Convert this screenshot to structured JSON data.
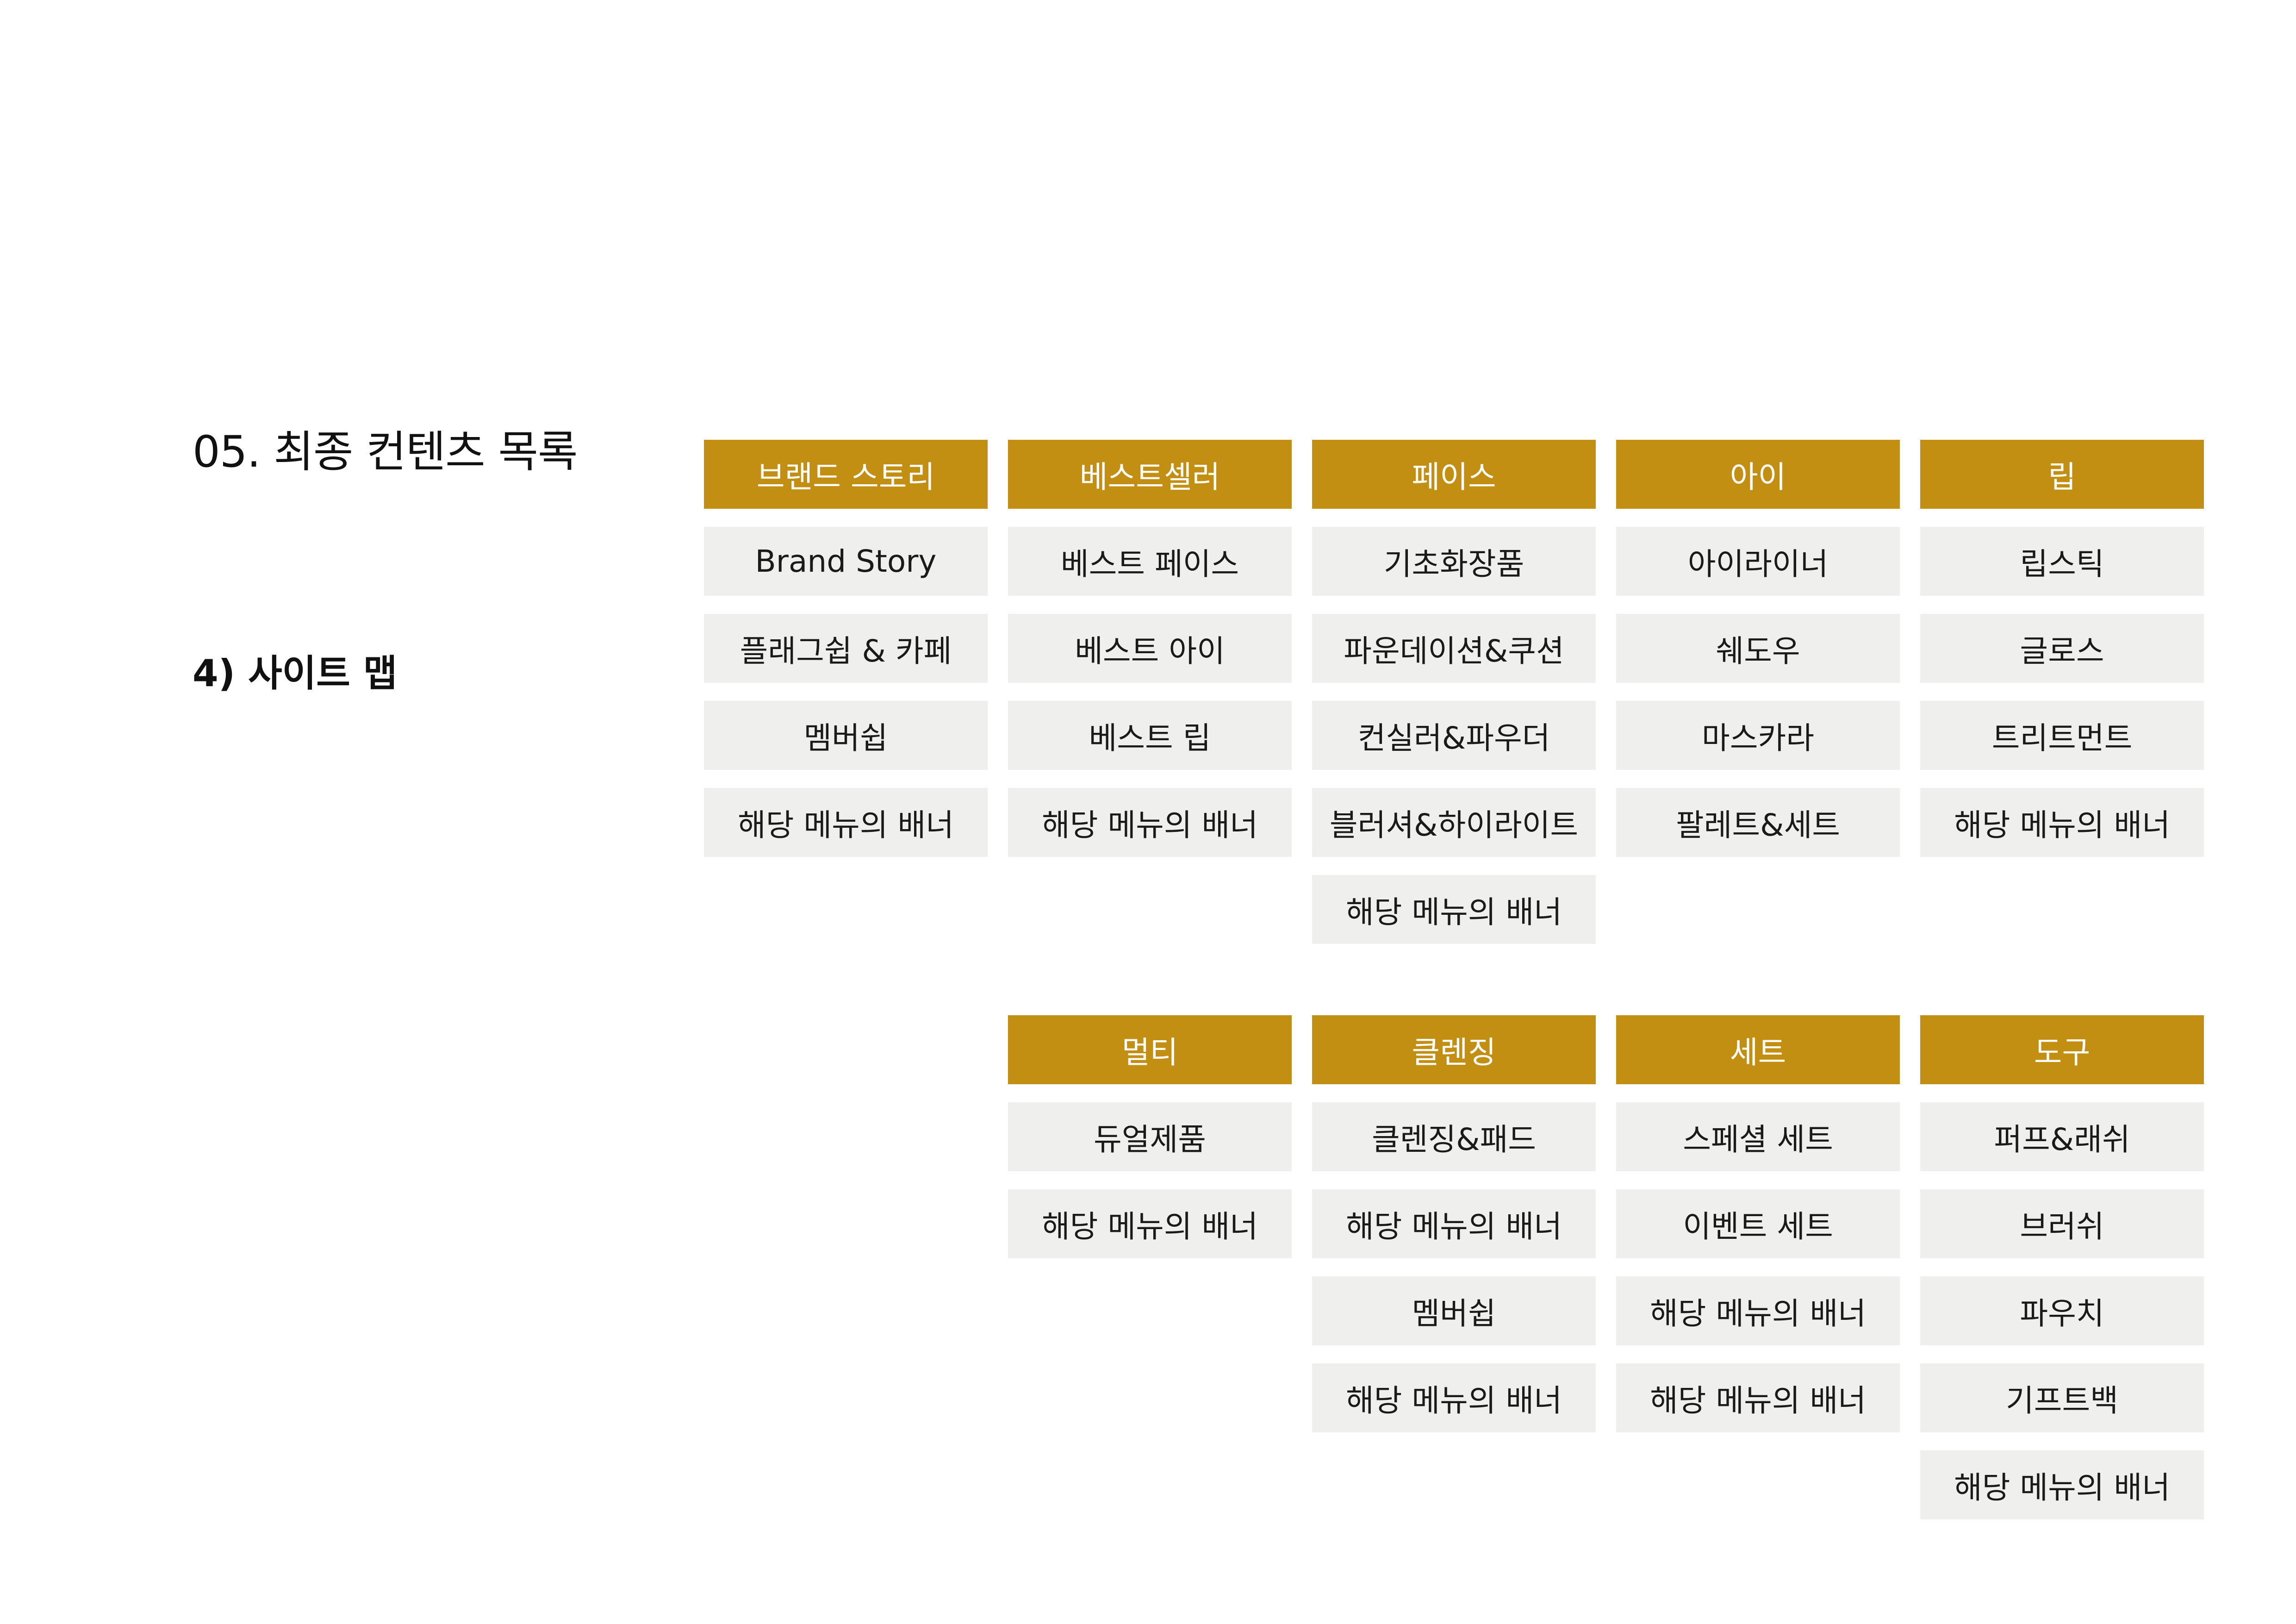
{
  "title": "05. 최종 컨텐츠 목록",
  "section": "4) 사이트 맵",
  "colors": {
    "header_bg": "#c28f12",
    "header_text": "#ffffff",
    "item_bg": "#efefed",
    "item_text": "#1a1a1a"
  },
  "columns": [
    {
      "header": "브랜드 스토리",
      "items": [
        "Brand Story",
        "플래그쉽 & 카페",
        "멤버쉽",
        "해당 메뉴의 배너"
      ]
    },
    {
      "header": "베스트셀러",
      "items": [
        "베스트 페이스",
        "베스트 아이",
        "베스트 립",
        "해당 메뉴의 배너"
      ]
    },
    {
      "header": "페이스",
      "items": [
        "기초화장품",
        "파운데이션&쿠션",
        "컨실러&파우더",
        "블러셔&하이라이트",
        "해당 메뉴의 배너"
      ]
    },
    {
      "header": "아이",
      "items": [
        "아이라이너",
        "쉐도우",
        "마스카라",
        "팔레트&세트"
      ]
    },
    {
      "header": "립",
      "items": [
        "립스틱",
        "글로스",
        "트리트먼트",
        "해당 메뉴의 배너"
      ]
    },
    {
      "header": "멀티",
      "items": [
        "듀얼제품",
        "해당 메뉴의 배너"
      ]
    },
    {
      "header": "클렌징",
      "items": [
        "클렌징&패드",
        "해당 메뉴의 배너",
        "멤버쉽",
        "해당 메뉴의 배너"
      ]
    },
    {
      "header": "세트",
      "items": [
        "스페셜 세트",
        "이벤트 세트",
        "해당 메뉴의 배너",
        "해당 메뉴의 배너"
      ]
    },
    {
      "header": "도구",
      "items": [
        "퍼프&래쉬",
        "브러쉬",
        "파우치",
        "기프트백",
        "해당 메뉴의 배너"
      ]
    }
  ]
}
